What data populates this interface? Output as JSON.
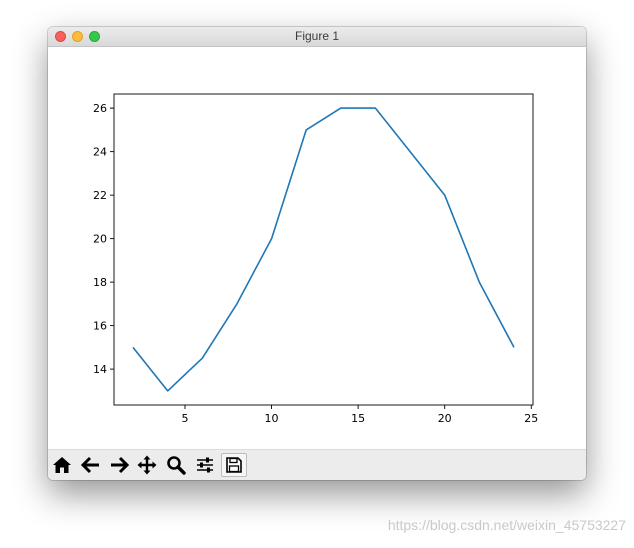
{
  "window": {
    "title": "Figure 1"
  },
  "toolbar": {
    "buttons": [
      {
        "name": "home-button",
        "icon": "home-icon"
      },
      {
        "name": "back-button",
        "icon": "arrow-left-icon"
      },
      {
        "name": "forward-button",
        "icon": "arrow-right-icon"
      },
      {
        "name": "pan-button",
        "icon": "move-icon"
      },
      {
        "name": "zoom-button",
        "icon": "magnifier-icon"
      },
      {
        "name": "configure-subplots-button",
        "icon": "sliders-icon"
      },
      {
        "name": "save-button",
        "icon": "floppy-disk-icon"
      }
    ]
  },
  "watermark": "https://blog.csdn.net/weixin_45753227",
  "colors": {
    "line": "#1f77b4",
    "toolbar_bg": "#ececec"
  },
  "chart_data": {
    "type": "line",
    "title": "",
    "xlabel": "",
    "ylabel": "",
    "x": [
      2,
      4,
      6,
      8,
      10,
      12,
      14,
      16,
      18,
      20,
      22,
      24
    ],
    "series": [
      {
        "values": [
          15,
          13,
          14.5,
          17,
          20,
          25,
          26,
          26,
          24,
          22,
          18,
          15
        ]
      }
    ],
    "xlim": [
      0.9,
      25.1
    ],
    "ylim": [
      12.35,
      26.65
    ],
    "xticks": [
      5,
      10,
      15,
      20,
      25
    ],
    "yticks": [
      14,
      16,
      18,
      20,
      22,
      24,
      26
    ],
    "grid": false,
    "legend": "none"
  }
}
